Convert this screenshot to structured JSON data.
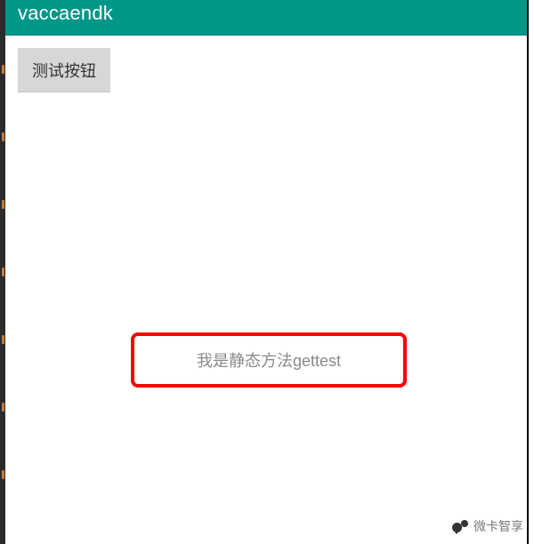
{
  "titlebar": {
    "title": "vaccaendk"
  },
  "content": {
    "test_button_label": "测试按钮",
    "static_method_text": "我是静态方法gettest"
  },
  "watermark": {
    "text": "微卡智享"
  }
}
